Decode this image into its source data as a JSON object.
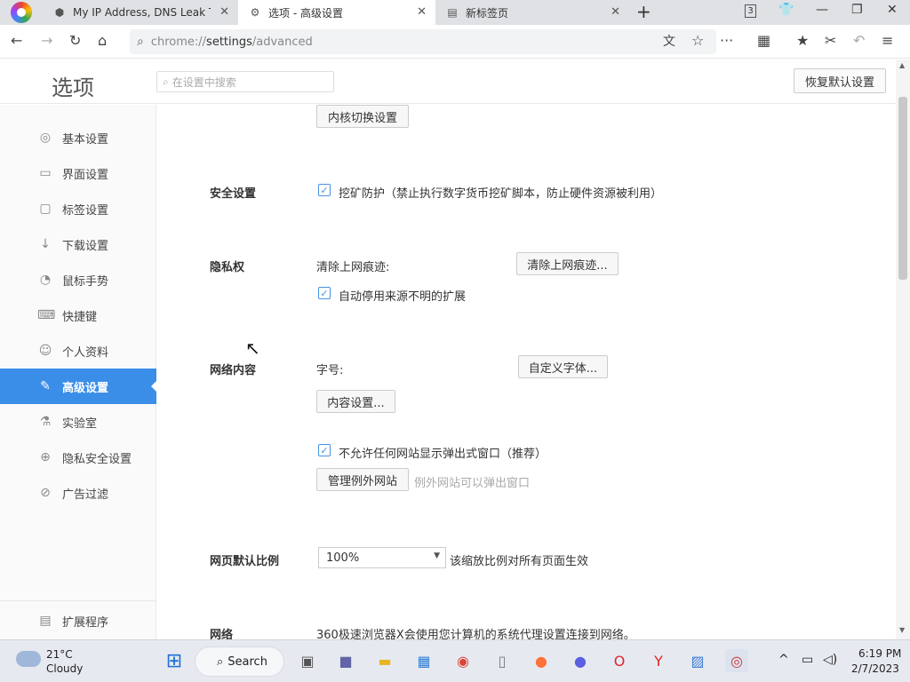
{
  "tabs": [
    {
      "label": "My IP Address, DNS Leak Test",
      "icon": "shield-icon"
    },
    {
      "label": "选项 - 高级设置",
      "icon": "gear-icon"
    },
    {
      "label": "新标签页",
      "icon": "newtab-icon"
    }
  ],
  "window": {
    "tab_count": "3"
  },
  "toolbar": {
    "url_prefix": "chrome://",
    "url_main": "settings",
    "url_suffix": "/advanced"
  },
  "header": {
    "title": "选项",
    "search_placeholder": "在设置中搜索",
    "restore_label": "恢复默认设置"
  },
  "sidebar": {
    "items": [
      {
        "label": "基本设置",
        "icon": "circle-settings-icon"
      },
      {
        "label": "界面设置",
        "icon": "window-icon"
      },
      {
        "label": "标签设置",
        "icon": "tab-icon"
      },
      {
        "label": "下载设置",
        "icon": "download-icon"
      },
      {
        "label": "鼠标手势",
        "icon": "mouse-icon"
      },
      {
        "label": "快捷键",
        "icon": "keyboard-icon"
      },
      {
        "label": "个人资料",
        "icon": "person-icon"
      },
      {
        "label": "高级设置",
        "icon": "wrench-icon",
        "active": true
      },
      {
        "label": "实验室",
        "icon": "flask-icon"
      },
      {
        "label": "隐私安全设置",
        "icon": "shield-plus-icon"
      },
      {
        "label": "广告过滤",
        "icon": "block-icon"
      }
    ],
    "extensions_label": "扩展程序"
  },
  "main": {
    "kernel_btn": "内核切换设置",
    "security": {
      "title": "安全设置",
      "mining_label": "挖矿防护（禁止执行数字货币挖矿脚本，防止硬件资源被利用）",
      "mining_checked": true
    },
    "privacy": {
      "title": "隐私权",
      "clear_label": "清除上网痕迹:",
      "clear_btn": "清除上网痕迹...",
      "auto_disable_label": "自动停用来源不明的扩展",
      "auto_disable_checked": true
    },
    "web_content": {
      "title": "网络内容",
      "font_size_label": "字号:",
      "custom_font_btn": "自定义字体...",
      "content_settings_btn": "内容设置...",
      "popup_label": "不允许任何网站显示弹出式窗口（推荐）",
      "popup_checked": true,
      "manage_exceptions_btn": "管理例外网站",
      "exceptions_hint": "例外网站可以弹出窗口"
    },
    "zoom": {
      "title": "网页默认比例",
      "value": "100%",
      "hint": "该缩放比例对所有页面生效"
    },
    "network": {
      "title": "网络",
      "text": "360极速浏览器X会使用您计算机的系统代理设置连接到网络。"
    }
  },
  "taskbar": {
    "weather_temp": "21°C",
    "weather_desc": "Cloudy",
    "search_label": "Search",
    "time": "6:19 PM",
    "date": "2/7/2023"
  }
}
